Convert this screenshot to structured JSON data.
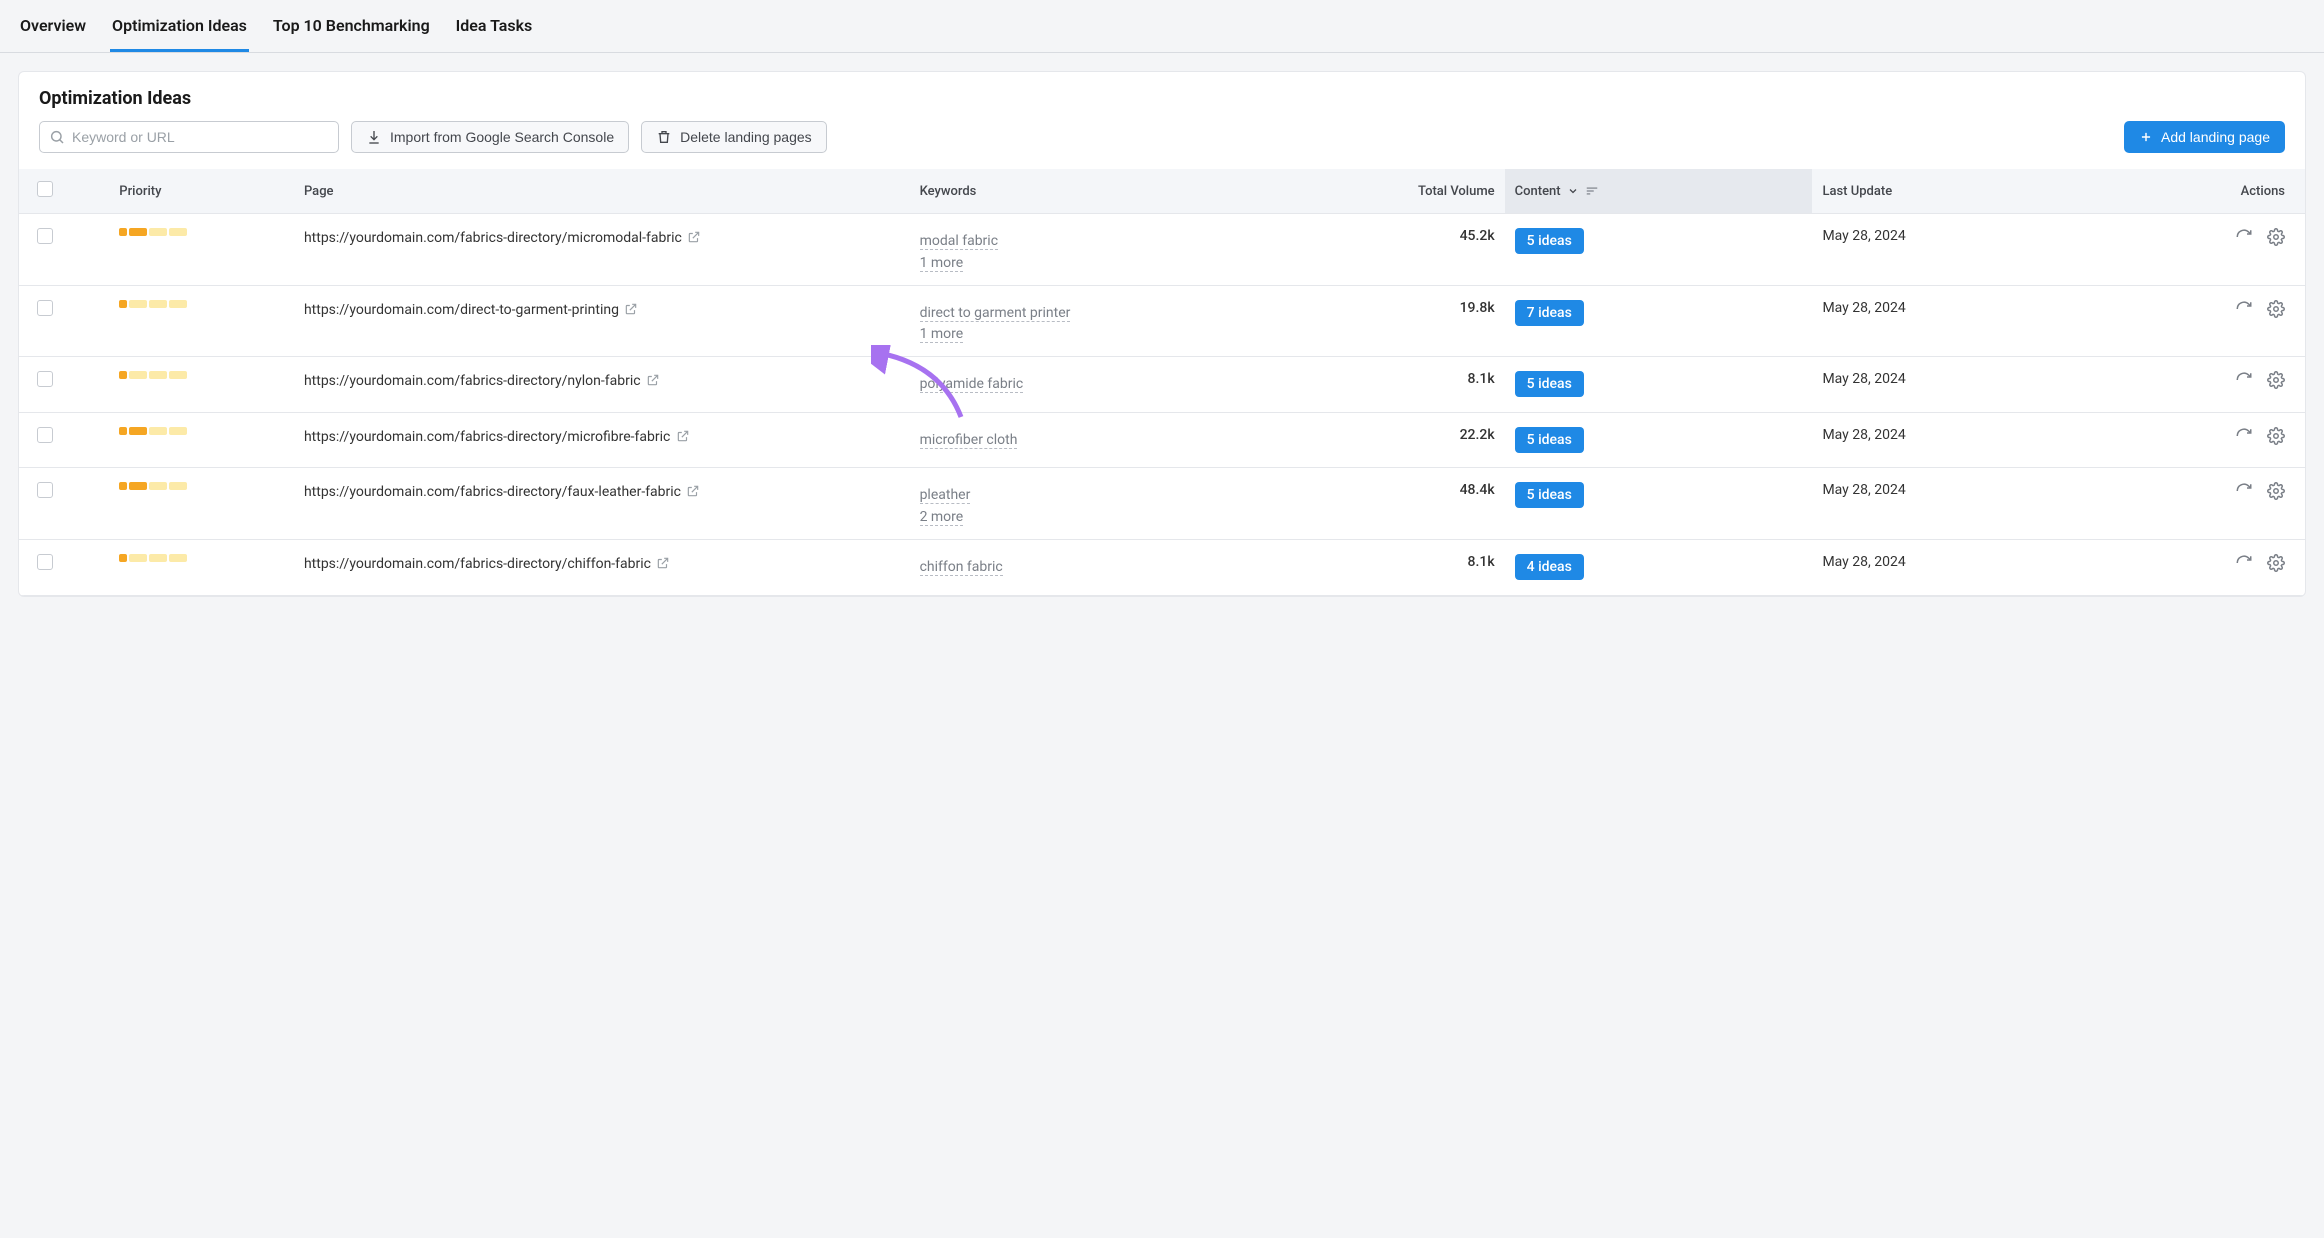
{
  "tabs": [
    {
      "label": "Overview",
      "active": false
    },
    {
      "label": "Optimization Ideas",
      "active": true
    },
    {
      "label": "Top 10 Benchmarking",
      "active": false
    },
    {
      "label": "Idea Tasks",
      "active": false
    }
  ],
  "panel": {
    "title": "Optimization Ideas"
  },
  "toolbar": {
    "search_placeholder": "Keyword or URL",
    "import_label": "Import from Google Search Console",
    "delete_label": "Delete landing pages",
    "add_label": "Add landing page"
  },
  "columns": {
    "priority": "Priority",
    "page": "Page",
    "keywords": "Keywords",
    "volume": "Total Volume",
    "content": "Content",
    "update": "Last Update",
    "actions": "Actions"
  },
  "rows": [
    {
      "priority": [
        true,
        true,
        false,
        false
      ],
      "page": "https://yourdomain.com/fabrics-directory/micromodal-fabric",
      "keywords": [
        "modal fabric"
      ],
      "more": "1 more",
      "volume": "45.2k",
      "ideas": "5 ideas",
      "update": "May 28, 2024"
    },
    {
      "priority": [
        true,
        false,
        false,
        false
      ],
      "page": "https://yourdomain.com/direct-to-garment-printing",
      "keywords": [
        "direct to garment printer"
      ],
      "more": "1 more",
      "volume": "19.8k",
      "ideas": "7 ideas",
      "update": "May 28, 2024"
    },
    {
      "priority": [
        true,
        false,
        false,
        false
      ],
      "page": "https://yourdomain.com/fabrics-directory/nylon-fabric",
      "keywords": [
        "polyamide fabric"
      ],
      "more": "",
      "volume": "8.1k",
      "ideas": "5 ideas",
      "update": "May 28, 2024"
    },
    {
      "priority": [
        true,
        true,
        false,
        false
      ],
      "page": "https://yourdomain.com/fabrics-directory/microfibre-fabric",
      "keywords": [
        "microfiber cloth"
      ],
      "more": "",
      "volume": "22.2k",
      "ideas": "5 ideas",
      "update": "May 28, 2024"
    },
    {
      "priority": [
        true,
        true,
        false,
        false
      ],
      "page": "https://yourdomain.com/fabrics-directory/faux-leather-fabric",
      "keywords": [
        "pleather"
      ],
      "more": "2 more",
      "volume": "48.4k",
      "ideas": "5 ideas",
      "update": "May 28, 2024"
    },
    {
      "priority": [
        true,
        false,
        false,
        false
      ],
      "page": "https://yourdomain.com/fabrics-directory/chiffon-fabric",
      "keywords": [
        "chiffon fabric"
      ],
      "more": "",
      "volume": "8.1k",
      "ideas": "4 ideas",
      "update": "May 28, 2024"
    }
  ]
}
